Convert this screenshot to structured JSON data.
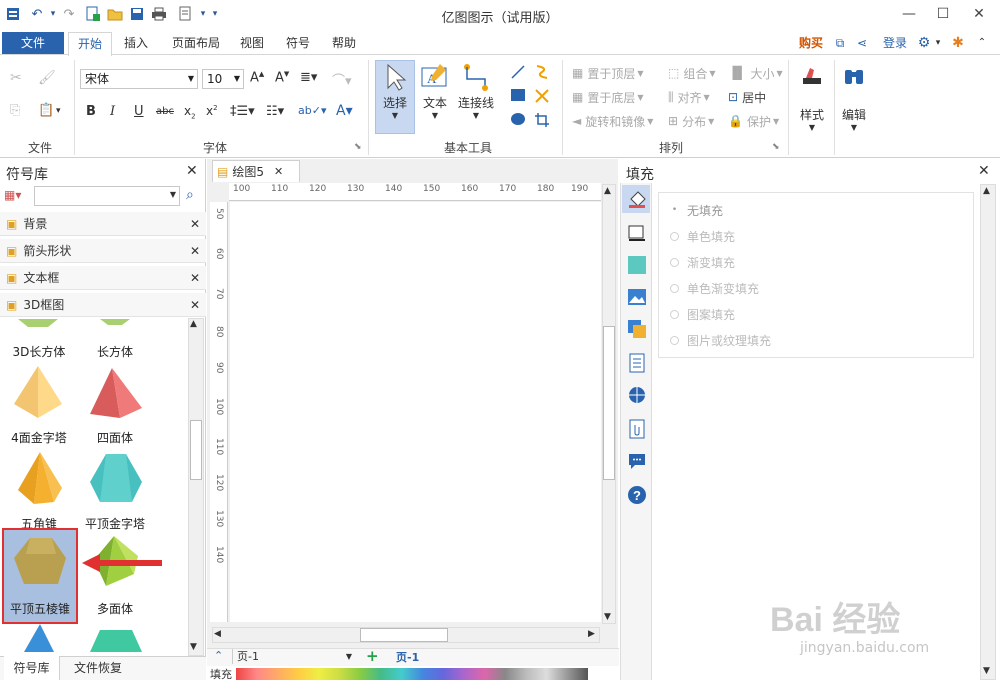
{
  "window": {
    "title": "亿图图示（试用版）"
  },
  "menu_tabs": [
    "文件",
    "开始",
    "插入",
    "页面布局",
    "视图",
    "符号",
    "帮助"
  ],
  "top_right": {
    "buy": "购买",
    "login": "登录"
  },
  "ribbon": {
    "file_group": "文件",
    "font_group": "字体",
    "font_name": "宋体",
    "font_size": "10",
    "basic_tools_group": "基本工具",
    "select": "选择",
    "text": "文本",
    "connector": "连接线",
    "arrange_group": "排列",
    "bring_front": "置于顶层",
    "send_back": "置于底层",
    "rotate_mirror": "旋转和镜像",
    "group": "组合",
    "align": "对齐",
    "distribute": "分布",
    "size": "大小",
    "center": "居中",
    "protect": "保护",
    "style": "样式",
    "edit": "编辑"
  },
  "left_panel": {
    "title": "符号库",
    "categories": [
      "背景",
      "箭头形状",
      "文本框",
      "3D框图"
    ],
    "shapes": [
      "3D长方体",
      "长方体",
      "4面金字塔",
      "四面体",
      "五角锥",
      "平顶金字塔",
      "平顶五棱锥",
      "多面体"
    ],
    "bottom_tabs": [
      "符号库",
      "文件恢复"
    ]
  },
  "document": {
    "tab": "绘图5",
    "ruler_top": [
      "100",
      "110",
      "120",
      "130",
      "140",
      "150",
      "160",
      "170",
      "180",
      "190"
    ],
    "ruler_left": [
      "50",
      "60",
      "70",
      "80",
      "90",
      "100",
      "110",
      "120",
      "130",
      "140"
    ],
    "page_selector": "页-1",
    "page_tab": "页-1",
    "fill_label": "填充"
  },
  "fill_panel": {
    "title": "填充",
    "options": [
      "无填充",
      "单色填充",
      "渐变填充",
      "单色渐变填充",
      "图案填充",
      "图片或纹理填充"
    ]
  },
  "watermark": {
    "line1": "Bai 经验",
    "line2": "jingyan.baidu.com"
  },
  "colors": {
    "accent": "#2a63ad",
    "highlight": "#c8d8f0",
    "selected_border": "#e03030"
  }
}
